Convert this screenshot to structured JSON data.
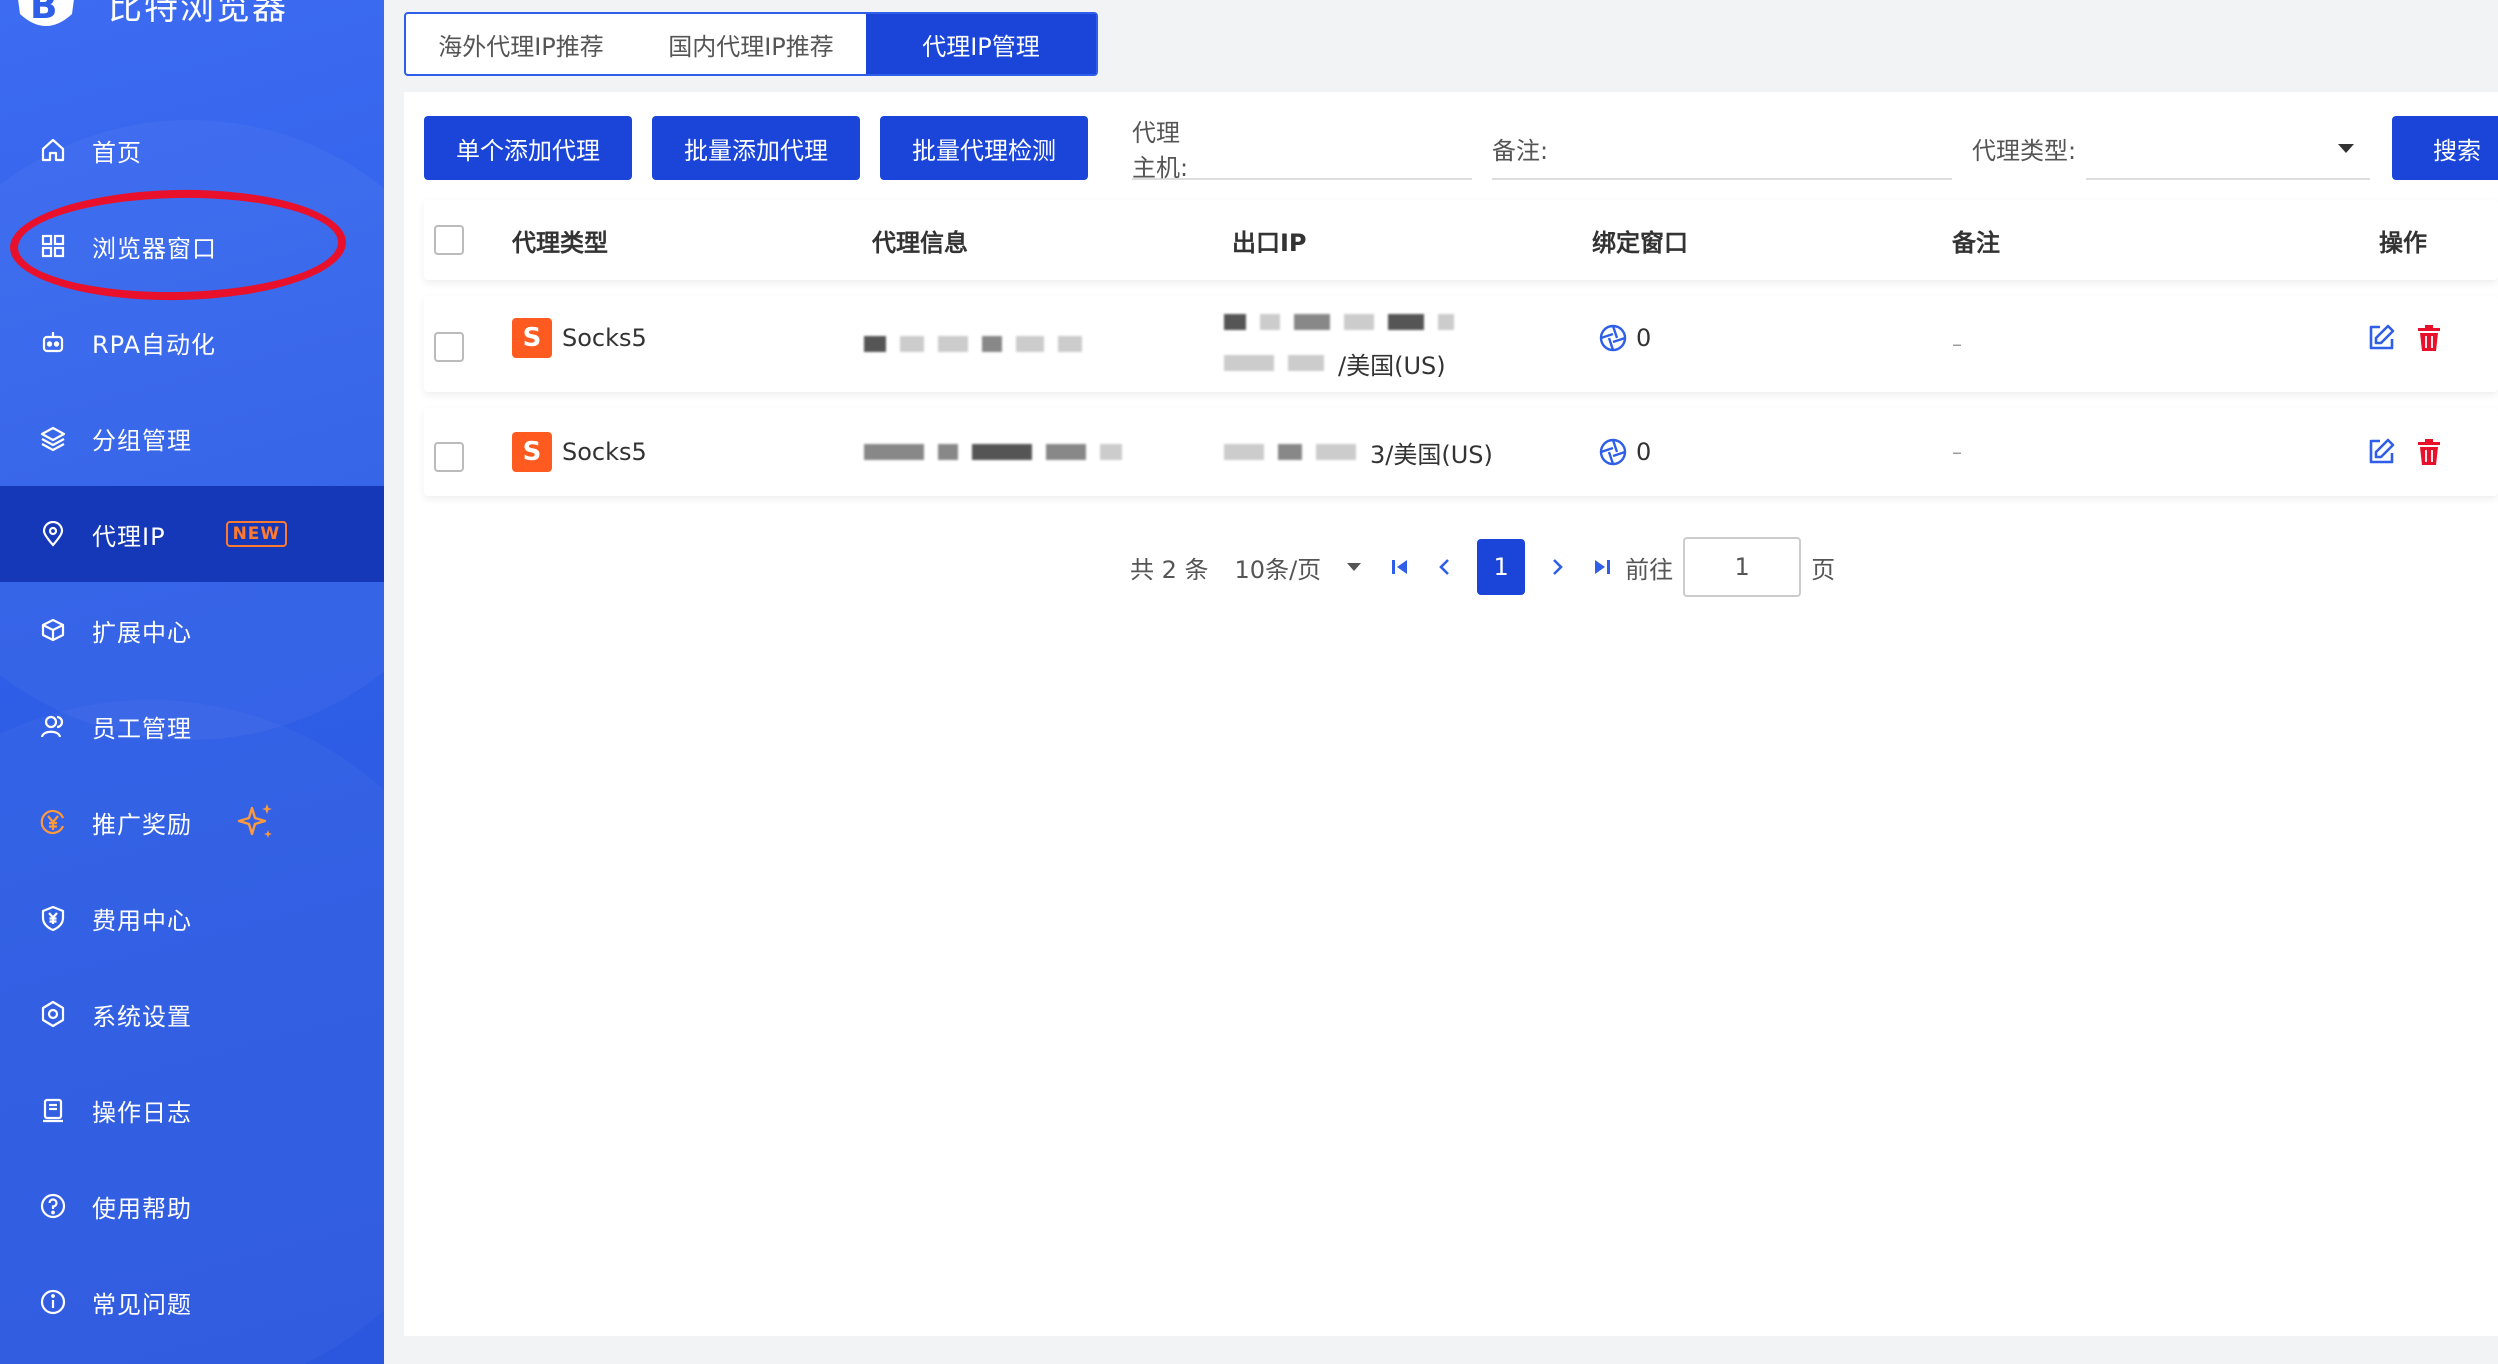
{
  "app": {
    "name": "比特浏览器"
  },
  "sidebar": {
    "items": [
      {
        "label": "首页",
        "icon": "home-icon"
      },
      {
        "label": "浏览器窗口",
        "icon": "grid-icon"
      },
      {
        "label": "RPA自动化",
        "icon": "robot-icon"
      },
      {
        "label": "分组管理",
        "icon": "layers-icon"
      },
      {
        "label": "代理IP",
        "icon": "location-icon",
        "badge": "NEW",
        "active": true
      },
      {
        "label": "扩展中心",
        "icon": "cube-icon"
      },
      {
        "label": "员工管理",
        "icon": "users-icon"
      },
      {
        "label": "推广奖励",
        "icon": "yen-circle-icon",
        "extra_icon": "sparkle-icon"
      },
      {
        "label": "费用中心",
        "icon": "yen-shield-icon"
      },
      {
        "label": "系统设置",
        "icon": "settings-icon"
      },
      {
        "label": "操作日志",
        "icon": "log-icon"
      },
      {
        "label": "使用帮助",
        "icon": "help-icon"
      },
      {
        "label": "常见问题",
        "icon": "info-icon"
      }
    ]
  },
  "tabs": [
    {
      "label": "海外代理IP推荐",
      "active": false
    },
    {
      "label": "国内代理IP推荐",
      "active": false
    },
    {
      "label": "代理IP管理",
      "active": true
    }
  ],
  "toolbar": {
    "add_single": "单个添加代理",
    "add_batch": "批量添加代理",
    "check_batch": "批量代理检测",
    "host_label": "代理主机:",
    "remark_label": "备注:",
    "type_label": "代理类型:",
    "search": "搜索"
  },
  "table": {
    "headers": [
      "代理类型",
      "代理信息",
      "出口IP",
      "绑定窗口",
      "备注",
      "操作"
    ],
    "rows": [
      {
        "type": "Socks5",
        "exit_ip_suffix": "/美国(US)",
        "bound": "0",
        "remark": "–"
      },
      {
        "type": "Socks5",
        "exit_ip_suffix": "3/美国(US)",
        "bound": "0",
        "remark": "–"
      }
    ]
  },
  "pagination": {
    "total": "共 2 条",
    "page_size": "10条/页",
    "current": "1",
    "goto_label": "前往",
    "goto_value": "1",
    "page_suffix": "页"
  },
  "colors": {
    "primary": "#1a45d8",
    "sidebar": "#2f5fe8",
    "danger": "#e8102a",
    "accent": "#ff7a2f"
  }
}
